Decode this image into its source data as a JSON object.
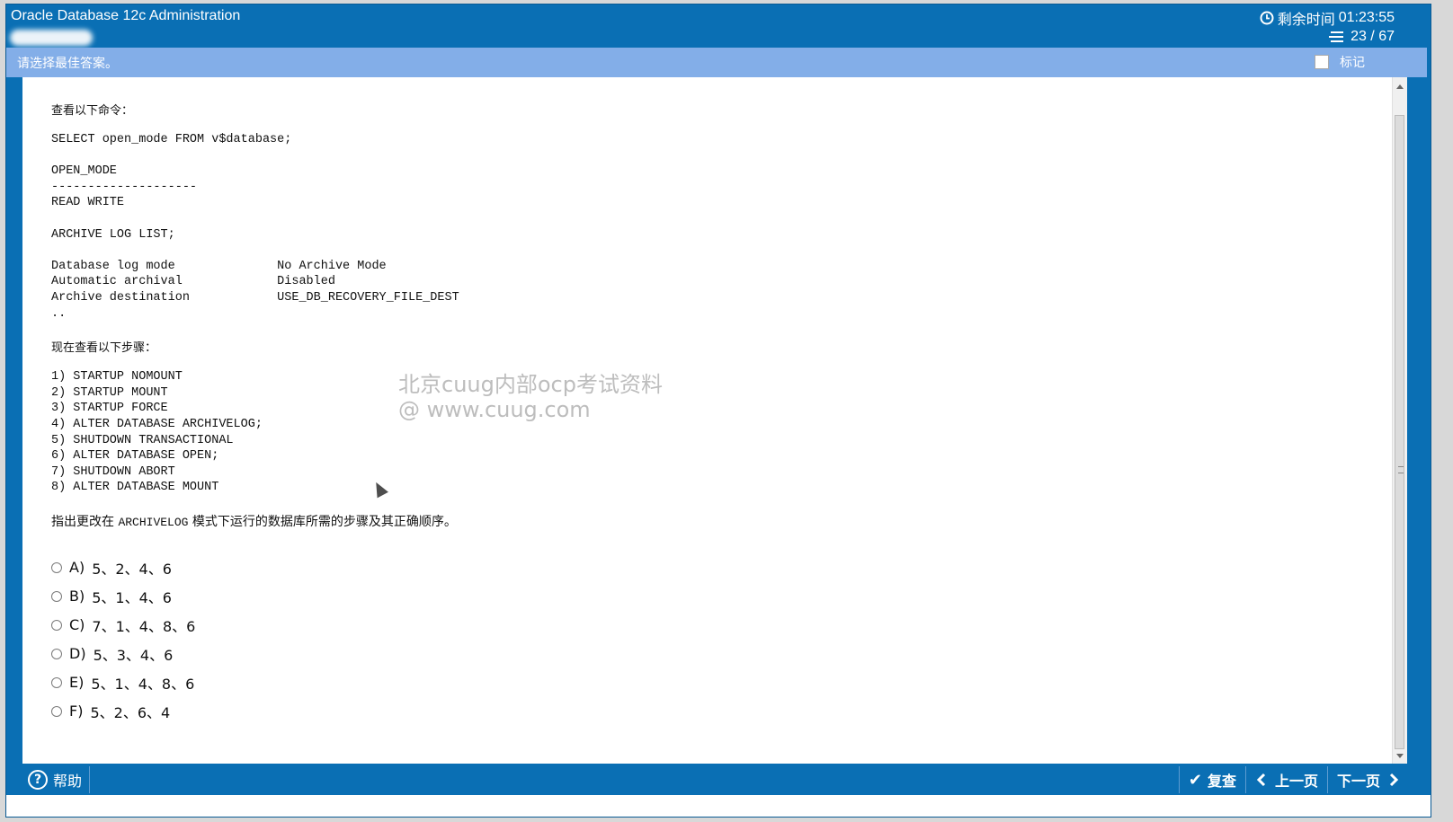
{
  "window": {
    "title": "Oracle Database 12c Administration",
    "timer_label": "剩余时间",
    "timer_value": "01:23:55",
    "counter": "23 / 67"
  },
  "instruction": {
    "text": "请选择最佳答案。",
    "mark_label": "标记"
  },
  "question": {
    "intro_label": "查看以下命令：",
    "code_block_1": "SELECT open_mode FROM v$database;\n\nOPEN_MODE\n--------------------\nREAD WRITE\n\nARCHIVE LOG LIST;\n\nDatabase log mode              No Archive Mode\nAutomatic archival             Disabled\nArchive destination            USE_DB_RECOVERY_FILE_DEST\n..",
    "steps_label": "现在查看以下步骤：",
    "code_block_2": "1) STARTUP NOMOUNT\n2) STARTUP MOUNT\n3) STARTUP FORCE\n4) ALTER DATABASE ARCHIVELOG;\n5) SHUTDOWN TRANSACTIONAL\n6) ALTER DATABASE OPEN;\n7) SHUTDOWN ABORT\n8) ALTER DATABASE MOUNT",
    "prompt_before": "指出更改在 ",
    "prompt_keyword": "ARCHIVELOG",
    "prompt_after": " 模式下运行的数据库所需的步骤及其正确顺序。",
    "options": [
      {
        "letter": "A)",
        "text": "5、2、4、6"
      },
      {
        "letter": "B)",
        "text": "5、1、4、6"
      },
      {
        "letter": "C)",
        "text": "7、1、4、8、6"
      },
      {
        "letter": "D)",
        "text": "5、3、4、6"
      },
      {
        "letter": "E)",
        "text": "5、1、4、8、6"
      },
      {
        "letter": "F)",
        "text": "5、2、6、4"
      }
    ]
  },
  "watermark": {
    "line1": "北京cuug内部ocp考试资料",
    "line2": "@ www.cuug.com"
  },
  "footer": {
    "help_label": "帮助",
    "review_label": "复查",
    "prev_label": "上一页",
    "next_label": "下一页"
  },
  "icons": {
    "timer": "clock-icon",
    "counter": "list-icon",
    "help": "question-circle-icon",
    "review": "check-icon",
    "prev": "arrow-left-icon",
    "next": "arrow-right-icon"
  }
}
